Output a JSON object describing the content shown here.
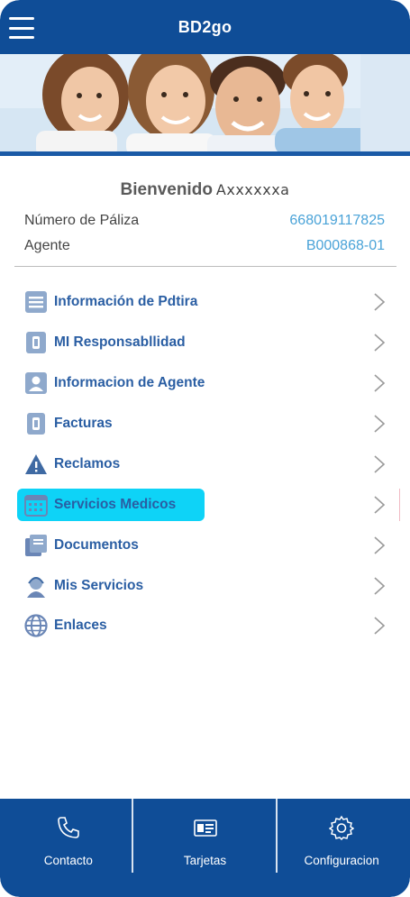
{
  "header": {
    "title": "BD2go",
    "menu_icon": "hamburger-icon"
  },
  "welcome": {
    "greeting": "Bienvenido",
    "username": "Axxxxxxa"
  },
  "policy": {
    "label": "Número de Páliza",
    "value": "668019117825"
  },
  "agent": {
    "label": "Agente",
    "value": "B000868-01"
  },
  "menu": {
    "items": [
      {
        "label": "Información de Pdtira",
        "icon": "document-icon"
      },
      {
        "label": "MI Responsabllidad",
        "icon": "id-card-icon"
      },
      {
        "label": "Informacion de Agente",
        "icon": "user-icon"
      },
      {
        "label": "Facturas",
        "icon": "invoice-icon"
      },
      {
        "label": "Reclamos",
        "icon": "warning-icon"
      },
      {
        "label": "Servicios Medicos",
        "icon": "calendar-icon",
        "active": true
      },
      {
        "label": "Documentos",
        "icon": "documents-icon"
      },
      {
        "label": "Mis Servicios",
        "icon": "agent-icon"
      },
      {
        "label": "Enlaces",
        "icon": "globe-icon"
      }
    ]
  },
  "bottom_nav": {
    "contacto": "Contacto",
    "tarjetas": "Tarjetas",
    "configuracion": "Configuracion"
  },
  "colors": {
    "brand": "#0f4d97",
    "link": "#2a5ea3",
    "value": "#4aa3d8",
    "highlight": "#0ed3f7"
  }
}
